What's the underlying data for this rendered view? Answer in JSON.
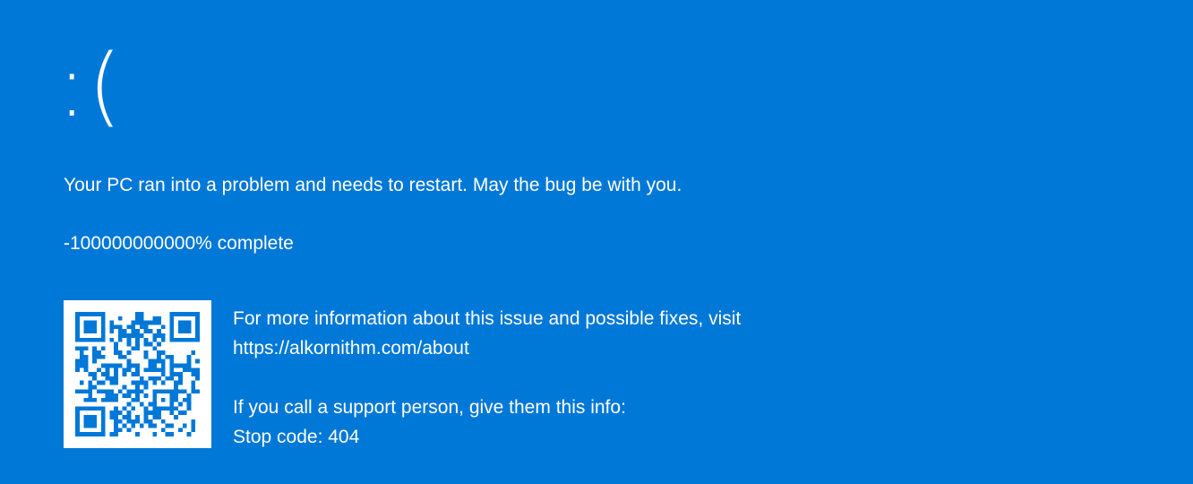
{
  "screen": {
    "background_color": "#0078d7",
    "text_color": "#ffffff",
    "sad_face": ":(",
    "headline": "Your PC ran into a problem and needs to restart. May the bug be with you.",
    "progress_text": "-100000000000% complete",
    "info": {
      "more_info_line": "For more information about this issue and possible fixes, visit",
      "url": "https://alkornithm.com/about",
      "support_line": "If you call a support person, give them this info:",
      "stop_code": "Stop code: 404"
    },
    "qr_code": {
      "icon": "qr-code-icon",
      "module_color": "#0078d7"
    }
  }
}
